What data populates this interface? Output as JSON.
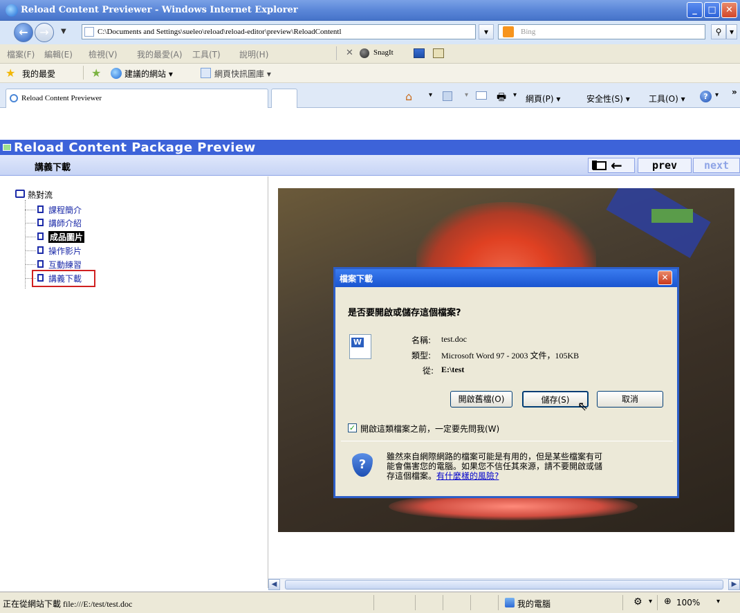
{
  "window": {
    "title": "Reload Content Previewer - Windows Internet Explorer"
  },
  "address_bar": {
    "url": "C:\\Documents and Settings\\sueleo\\reload\\reload-editor\\preview\\ReloadContentl",
    "search_placeholder": "Bing"
  },
  "menu": {
    "items": [
      "檔案(F)",
      "編輯(E)",
      "檢視(V)",
      "我的最愛(A)",
      "工具(T)",
      "說明(H)"
    ],
    "snagit": "SnagIt"
  },
  "favorites_bar": {
    "favorites": "我的最愛",
    "suggested": "建議的網站 ▾",
    "web_slice": "網頁快訊圖庫 ▾"
  },
  "tabs": {
    "active": "Reload Content Previewer"
  },
  "command_bar": {
    "page": "網頁(P) ▾",
    "safety": "安全性(S) ▾",
    "tools": "工具(O) ▾"
  },
  "reload": {
    "header": "Reload Content Package Preview",
    "subtitle": "講義下載",
    "prev": "prev",
    "next": "next"
  },
  "tree": {
    "root": "熱對流",
    "items": [
      {
        "label": "課程簡介"
      },
      {
        "label": "講師介紹"
      },
      {
        "label": "成品圖片"
      },
      {
        "label": "操作影片"
      },
      {
        "label": "互動練習"
      },
      {
        "label": "講義下載"
      }
    ]
  },
  "dialog": {
    "title": "檔案下載",
    "question": "是否要開啟或儲存這個檔案?",
    "name_label": "名稱:",
    "name_value": "test.doc",
    "type_label": "類型:",
    "type_value": "Microsoft Word 97 - 2003 文件，105KB",
    "from_label": "從:",
    "from_value": "E:\\test",
    "open_button": "開啟舊檔(O)",
    "save_button": "儲存(S)",
    "cancel_button": "取消",
    "checkbox_label": "開啟這類檔案之前，一定要先問我(W)",
    "warning_line1": "雖然來自網際網路的檔案可能是有用的，但是某些檔案有可",
    "warning_line2": "能會傷害您的電腦。如果您不信任其來源，請不要開啟或儲",
    "warning_line3": "存這個檔案。",
    "warning_link": "有什麼樣的風險?"
  },
  "status_bar": {
    "message": "正在從網站下載 file:///E:/test/test.doc",
    "zone": "我的電腦",
    "zoom": "100%"
  }
}
